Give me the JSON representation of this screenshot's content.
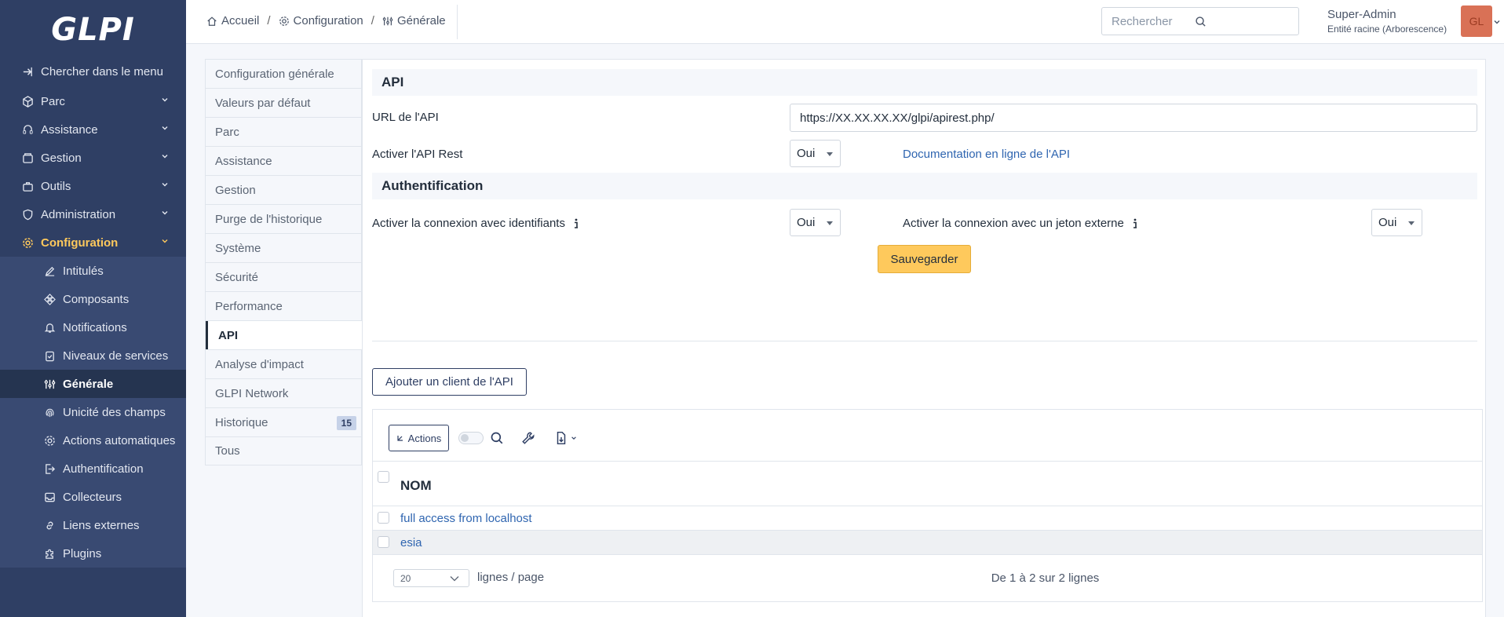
{
  "sidebar": {
    "logo": "GLPI",
    "search_menu": "Chercher dans le menu",
    "items": [
      {
        "label": "Parc"
      },
      {
        "label": "Assistance"
      },
      {
        "label": "Gestion"
      },
      {
        "label": "Outils"
      },
      {
        "label": "Administration"
      },
      {
        "label": "Configuration"
      }
    ],
    "subitems": [
      {
        "label": "Intitulés"
      },
      {
        "label": "Composants"
      },
      {
        "label": "Notifications"
      },
      {
        "label": "Niveaux de services"
      },
      {
        "label": "Générale"
      },
      {
        "label": "Unicité des champs"
      },
      {
        "label": "Actions automatiques"
      },
      {
        "label": "Authentification"
      },
      {
        "label": "Collecteurs"
      },
      {
        "label": "Liens externes"
      },
      {
        "label": "Plugins"
      }
    ]
  },
  "header": {
    "breadcrumb": [
      "Accueil",
      "Configuration",
      "Générale"
    ],
    "search_placeholder": "Rechercher",
    "user_name": "Super-Admin",
    "user_entity": "Entité racine (Arborescence)",
    "avatar_initials": "GL"
  },
  "tabs": [
    {
      "label": "Configuration générale"
    },
    {
      "label": "Valeurs par défaut"
    },
    {
      "label": "Parc"
    },
    {
      "label": "Assistance"
    },
    {
      "label": "Gestion"
    },
    {
      "label": "Purge de l'historique"
    },
    {
      "label": "Système"
    },
    {
      "label": "Sécurité"
    },
    {
      "label": "Performance"
    },
    {
      "label": "API"
    },
    {
      "label": "Analyse d'impact"
    },
    {
      "label": "GLPI Network"
    },
    {
      "label": "Historique",
      "badge": "15"
    },
    {
      "label": "Tous"
    }
  ],
  "api": {
    "section_title": "API",
    "url_label": "URL de l'API",
    "url_value": "https://XX.XX.XX.XX/glpi/apirest.php/",
    "enable_rest_label": "Activer l'API Rest",
    "enable_rest_value": "Oui",
    "doc_link": "Documentation en ligne de l'API"
  },
  "auth": {
    "section_title": "Authentification",
    "credentials_label": "Activer la connexion avec identifiants",
    "credentials_value": "Oui",
    "token_label": "Activer la connexion avec un jeton externe",
    "token_value": "Oui",
    "save_button": "Sauvegarder"
  },
  "clients": {
    "add_button": "Ajouter un client de l'API",
    "actions_button": "Actions",
    "column_header": "NOM",
    "rows": [
      {
        "name": "full access from localhost"
      },
      {
        "name": "esia"
      }
    ],
    "per_page_value": "20",
    "per_page_label": "lignes / page",
    "count_text": "De 1 à 2 sur 2 lignes"
  }
}
